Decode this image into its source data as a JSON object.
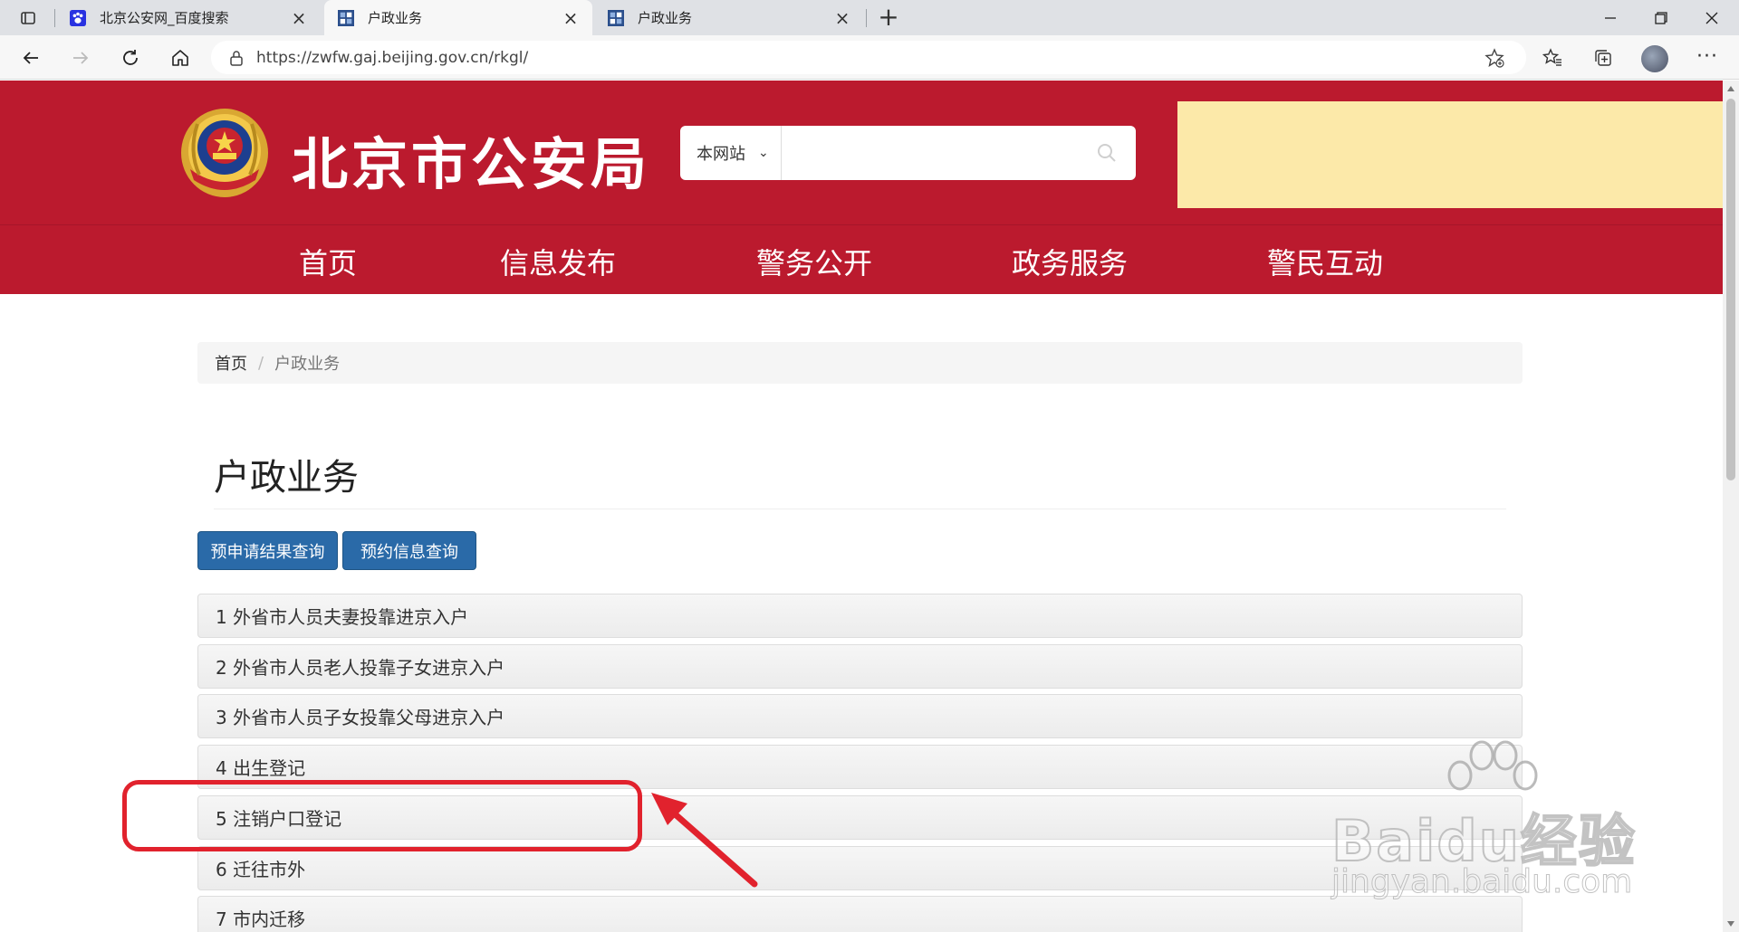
{
  "browser": {
    "tabs": [
      {
        "title": "北京公安网_百度搜索",
        "active": false
      },
      {
        "title": "户政业务",
        "active": true
      },
      {
        "title": "户政业务",
        "active": false
      }
    ],
    "url": "https://zwfw.gaj.beijing.gov.cn/rkgl/"
  },
  "header": {
    "site_title": "北京市公安局",
    "search_scope": "本网站",
    "banner_color": "#fce9a9",
    "brand_color": "#bb1a2e"
  },
  "nav": [
    "首页",
    "信息发布",
    "警务公开",
    "政务服务",
    "警民互动"
  ],
  "breadcrumb": {
    "home": "首页",
    "current": "户政业务"
  },
  "page": {
    "heading": "户政业务",
    "buttons": [
      "预申请结果查询",
      "预约信息查询"
    ],
    "services": [
      "1 外省市人员夫妻投靠进京入户",
      "2 外省市人员老人投靠子女进京入户",
      "3 外省市人员子女投靠父母进京入户",
      "4 出生登记",
      "5 注销户口登记",
      "6 迁往市外",
      "7 市内迁移"
    ]
  },
  "annotation": {
    "highlighted_item": "5 注销户口登记",
    "color": "#e1222d"
  },
  "watermark": {
    "main": "Baidu经验",
    "sub": "jingyan.baidu.com"
  }
}
